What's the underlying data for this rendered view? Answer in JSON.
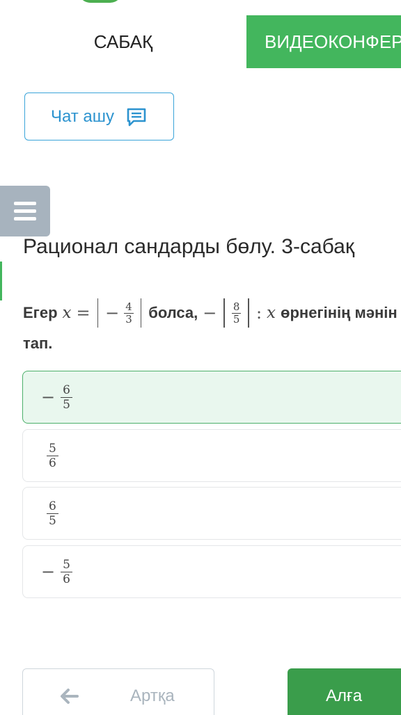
{
  "tabs": {
    "lesson": "САБАҚ",
    "video": "ВИДЕОКОНФЕРЕНЦИЯ"
  },
  "chat": {
    "label": "Чат ашу",
    "icon": "chat-icon"
  },
  "menu": {
    "icon": "hamburger-menu-icon"
  },
  "lesson": {
    "title": "Рационал сандарды бөлу. 3-сабақ"
  },
  "question": {
    "prefix": "Егер",
    "var": "x",
    "equals": "=",
    "minus": "−",
    "frac1_num": "4",
    "frac1_den": "3",
    "middle": "болса,",
    "frac2_num": "8",
    "frac2_den": "5",
    "colon": ":",
    "tail": "өрнегінің мәнін",
    "line2": "тап."
  },
  "options": [
    {
      "sign": "−",
      "num": "6",
      "den": "5",
      "selected": true
    },
    {
      "sign": "",
      "num": "5",
      "den": "6",
      "selected": false
    },
    {
      "sign": "",
      "num": "6",
      "den": "5",
      "selected": false
    },
    {
      "sign": "−",
      "num": "5",
      "den": "6",
      "selected": false
    }
  ],
  "nav": {
    "back_label": "Артқа",
    "next_label": "Алға",
    "back_icon": "arrow-left-icon"
  },
  "colors": {
    "accent_green": "#43b65d",
    "next_green": "#3a9d4b",
    "chat_blue": "#2c93cf",
    "menu_gray": "#a7b3be",
    "selected_bg": "#e9f7ee"
  }
}
